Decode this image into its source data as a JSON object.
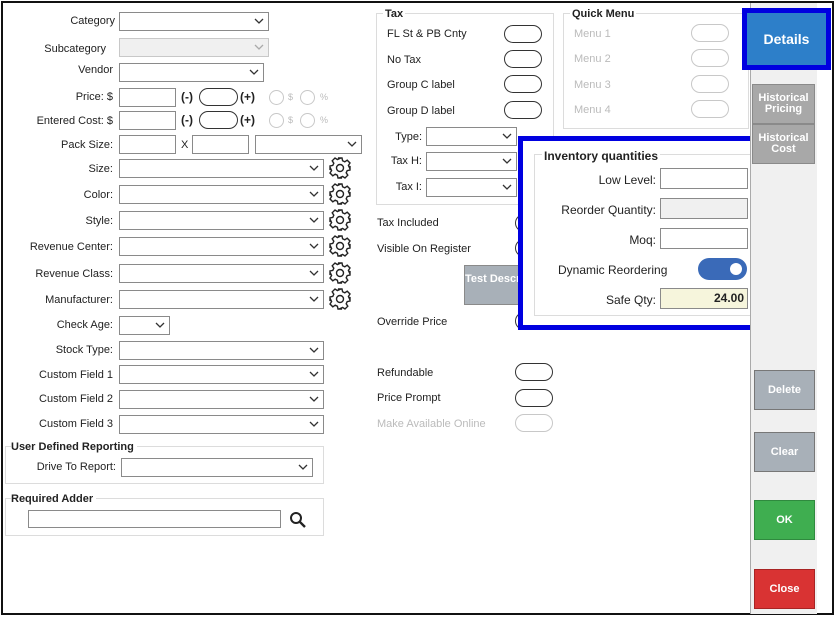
{
  "form": {
    "category": "Category",
    "subcategory": "Subcategory",
    "vendor": "Vendor",
    "price": "Price: $",
    "entered_cost": "Entered Cost: $",
    "pack_size": "Pack Size:",
    "pack_x": "X",
    "size": "Size:",
    "color": "Color:",
    "style": "Style:",
    "revenue_center": "Revenue Center:",
    "revenue_class": "Revenue Class:",
    "manufacturer": "Manufacturer:",
    "check_age": "Check Age:",
    "stock_type": "Stock Type:",
    "custom1": "Custom Field 1",
    "custom2": "Custom Field 2",
    "custom3": "Custom Field 3",
    "minus": "(-)",
    "plus": "(+)",
    "dollar": "$",
    "percent": "%"
  },
  "udr": {
    "title": "User Defined Reporting",
    "drive_to_report": "Drive To Report:"
  },
  "required_adder": {
    "title": "Required Adder"
  },
  "tax": {
    "title": "Tax",
    "items": [
      "FL St & PB Cnty",
      "No Tax",
      "Group C label",
      "Group D label"
    ],
    "type": "Type:",
    "tax_h": "Tax H:",
    "tax_i": "Tax I:"
  },
  "options": {
    "tax_included": "Tax Included",
    "visible_on_register": "Visible On Register",
    "test_desc": "Test Descrip",
    "override_price": "Override Price",
    "refundable": "Refundable",
    "price_prompt": "Price Prompt",
    "make_available_online": "Make Available Online"
  },
  "quick_menu": {
    "title": "Quick Menu",
    "items": [
      "Menu 1",
      "Menu 2",
      "Menu 3",
      "Menu 4"
    ]
  },
  "inventory": {
    "title": "Inventory quantities",
    "low_level": "Low Level:",
    "reorder_quantity": "Reorder Quantity:",
    "moq": "Moq:",
    "dynamic_reordering": "Dynamic Reordering",
    "safe_qty": "Safe Qty:",
    "safe_qty_value": "24.00"
  },
  "side": {
    "details": "Details",
    "historical_pricing": "Historical Pricing",
    "historical_cost": "Historical Cost",
    "delete": "Delete",
    "clear": "Clear",
    "ok": "OK",
    "close": "Close"
  },
  "colors": {
    "details_bg": "#2d7fc9",
    "ok_bg": "#3fae50",
    "close_bg": "#d93333",
    "disabled_btn_bg": "#a8b0b8",
    "highlight": "#0000e0",
    "toggle_on": "#3a6ab8",
    "safe_qty_bg": "#f6f5dc"
  }
}
